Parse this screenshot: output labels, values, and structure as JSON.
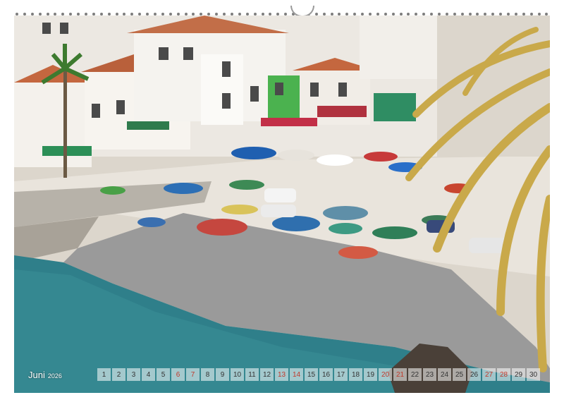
{
  "calendar": {
    "month": "Juni",
    "year": "2026",
    "days": [
      {
        "n": "1",
        "weekend": false
      },
      {
        "n": "2",
        "weekend": false
      },
      {
        "n": "3",
        "weekend": false
      },
      {
        "n": "4",
        "weekend": false
      },
      {
        "n": "5",
        "weekend": false
      },
      {
        "n": "6",
        "weekend": true
      },
      {
        "n": "7",
        "weekend": true
      },
      {
        "n": "8",
        "weekend": false
      },
      {
        "n": "9",
        "weekend": false
      },
      {
        "n": "10",
        "weekend": false
      },
      {
        "n": "11",
        "weekend": false
      },
      {
        "n": "12",
        "weekend": false
      },
      {
        "n": "13",
        "weekend": true
      },
      {
        "n": "14",
        "weekend": true
      },
      {
        "n": "15",
        "weekend": false
      },
      {
        "n": "16",
        "weekend": false
      },
      {
        "n": "17",
        "weekend": false
      },
      {
        "n": "18",
        "weekend": false
      },
      {
        "n": "19",
        "weekend": false
      },
      {
        "n": "20",
        "weekend": true
      },
      {
        "n": "21",
        "weekend": true
      },
      {
        "n": "22",
        "weekend": false
      },
      {
        "n": "23",
        "weekend": false
      },
      {
        "n": "24",
        "weekend": false
      },
      {
        "n": "25",
        "weekend": false
      },
      {
        "n": "26",
        "weekend": false
      },
      {
        "n": "27",
        "weekend": true
      },
      {
        "n": "28",
        "weekend": true
      },
      {
        "n": "29",
        "weekend": false
      },
      {
        "n": "30",
        "weekend": false
      }
    ]
  },
  "colors": {
    "weekend": "#c0392b",
    "sea": "#2f7f8a",
    "pebbles": "#9a9a9a",
    "plaza": "#e9e4dc",
    "roof": "#c4673f",
    "palm": "#c9a94a"
  }
}
